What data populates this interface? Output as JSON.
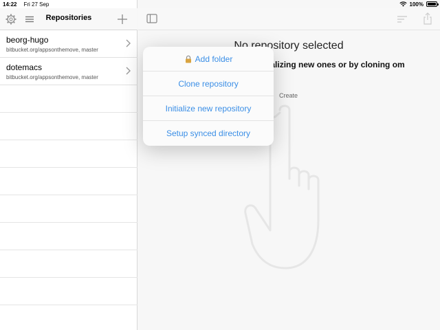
{
  "status_bar": {
    "time": "14:22",
    "date": "Fri 27 Sep",
    "battery": "100%"
  },
  "sidebar": {
    "title": "Repositories",
    "repos": [
      {
        "name": "beorg-hugo",
        "subtitle": "bitbucket.org/appsonthemove, master"
      },
      {
        "name": "dotemacs",
        "subtitle": "bitbucket.org/appsonthemove, master"
      }
    ]
  },
  "main": {
    "empty_title": "No repository selected",
    "empty_desc": "ries by initializing new ones or by cloning om remote.",
    "create_label": "Create"
  },
  "popover": {
    "items": [
      {
        "label": "Add folder",
        "icon": "lock-icon"
      },
      {
        "label": "Clone repository"
      },
      {
        "label": "Initialize new repository"
      },
      {
        "label": "Setup synced directory"
      }
    ]
  },
  "colors": {
    "accent": "#3a8ee6",
    "sidebar_bg": "#ffffff",
    "main_bg": "#f7f7f7"
  }
}
